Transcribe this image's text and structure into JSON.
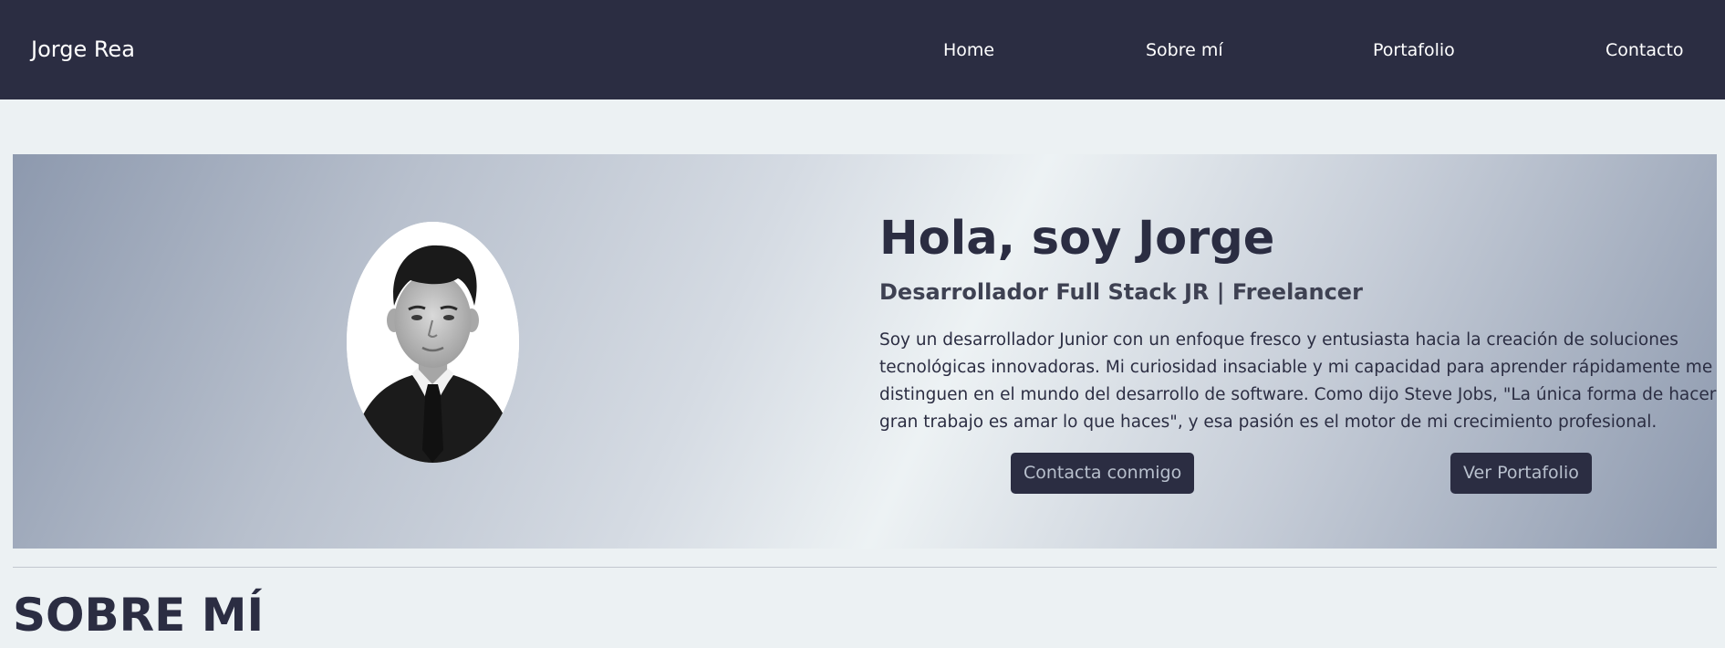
{
  "navbar": {
    "brand": "Jorge Rea",
    "links": [
      "Home",
      "Sobre mí",
      "Portafolio",
      "Contacto"
    ]
  },
  "hero": {
    "portrait_icon": "person-portrait",
    "title": "Hola, soy Jorge",
    "subtitle": "Desarrollador Full Stack JR | Freelancer",
    "description_lines": [
      "Soy un desarrollador Junior con un enfoque fresco y entusiasta hacia la creación de soluciones",
      "tecnológicas innovadoras. Mi curiosidad insaciable y mi capacidad para aprender rápidamente me",
      "distinguen en el mundo del desarrollo de software. Como dijo Steve Jobs, \"La única forma de hacer un",
      "gran trabajo es amar lo que haces\", y esa pasión es el motor de mi crecimiento profesional."
    ],
    "buttons": {
      "contact": "Contacta conmigo",
      "portfolio": "Ver Portafolio"
    }
  },
  "sections": {
    "about_title": "SOBRE MÍ"
  },
  "colors": {
    "navbar_bg": "#2b2d42",
    "page_bg": "#ecf1f3",
    "accent": "#8d99ae",
    "button_bg": "#2b2d42",
    "button_text": "#b8c0cd"
  }
}
